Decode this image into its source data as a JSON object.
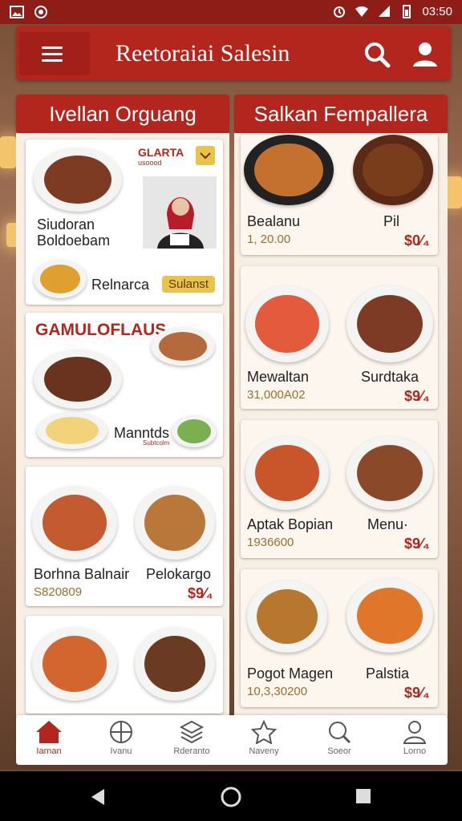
{
  "status": {
    "time": "03:50"
  },
  "app": {
    "title": "Reetoraiai Salesin"
  },
  "columns": {
    "left_title": "Ivellan Orguang",
    "right_title": "Salkan Fempallera"
  },
  "left_cards": [
    {
      "name": "Siudoran",
      "sub": "Boldoebam",
      "promo_title": "GLARTA",
      "promo_sub": "usoood",
      "item2": "Relnarca",
      "badge": "Sulanst"
    },
    {
      "banner": "GAMULOFLAUS",
      "item": "Manntds",
      "item_sub": "Subtcolm"
    },
    {
      "name": "Borhna Balnair",
      "price_text": "S820809",
      "name2": "Pelokargo",
      "price": "$9⁄₄"
    },
    {
      "name": "",
      "name2": ""
    }
  ],
  "right_cards": [
    {
      "name": "Bealanu",
      "price_text": "1, 20.00",
      "name2": "Pil",
      "price": "$0⁄₄"
    },
    {
      "name": "Mewaltan",
      "price_text": "31,000A02",
      "name2": "Surdtaka",
      "price": "$9⁄₄"
    },
    {
      "name": "Aptak Bopian",
      "price_text": "1936600",
      "name2": "Menu·",
      "price": "$9⁄₄"
    },
    {
      "name": "Pogot Magen",
      "price_text": "10,3,30200",
      "name2": "Palstia",
      "price": "$9⁄₄"
    }
  ],
  "nav": [
    {
      "label": "Iarnan",
      "icon": "home-icon"
    },
    {
      "label": "Ivanu",
      "icon": "grid-icon"
    },
    {
      "label": "Rderanto",
      "icon": "layers-icon"
    },
    {
      "label": "Naveny",
      "icon": "star-icon"
    },
    {
      "label": "Soeor",
      "icon": "search-icon"
    },
    {
      "label": "Lorno",
      "icon": "user-icon"
    }
  ],
  "colors": {
    "brand": "#b3261e",
    "accent": "#e9c34a",
    "panel": "#f7efe4"
  }
}
